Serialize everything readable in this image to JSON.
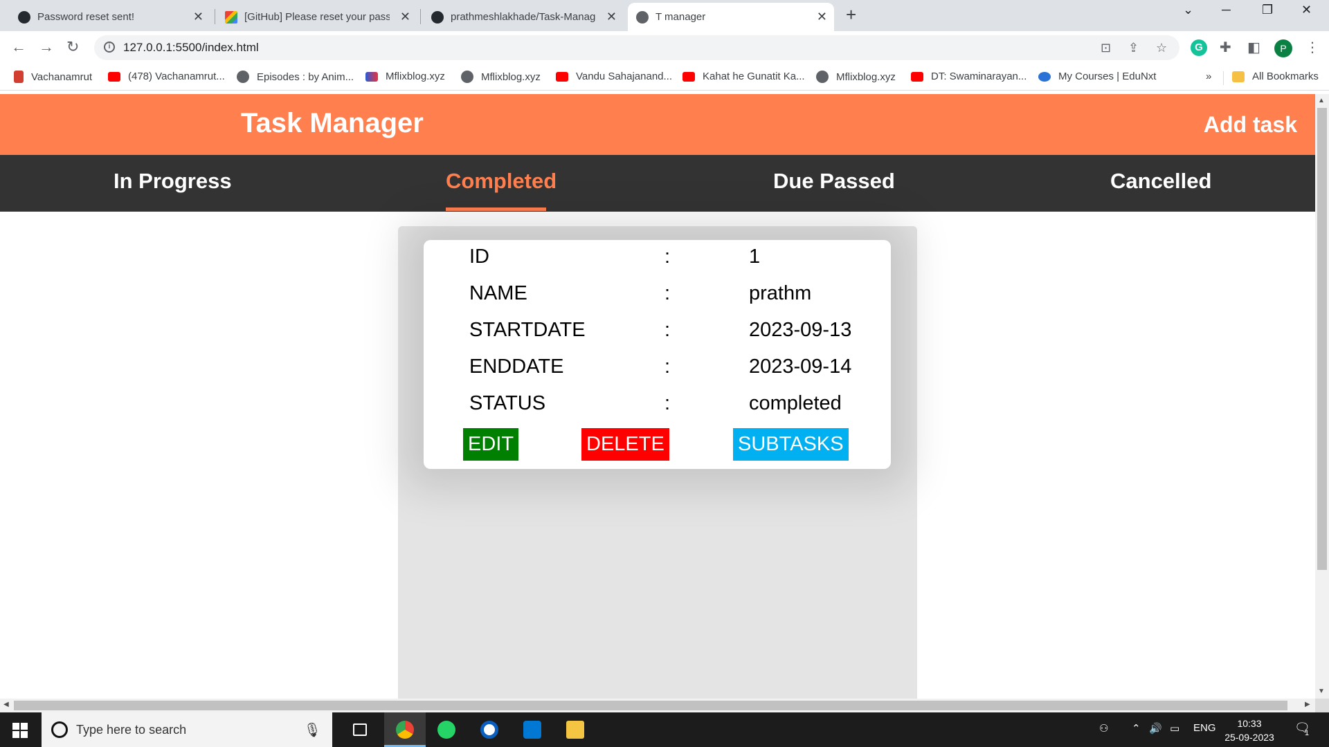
{
  "browser": {
    "tabs": [
      {
        "title": "Password reset sent!",
        "icon": "github-icon"
      },
      {
        "title": "[GitHub] Please reset your passw",
        "icon": "gmail-icon"
      },
      {
        "title": "prathmeshlakhade/Task-Manage",
        "icon": "github-icon"
      },
      {
        "title": "T manager",
        "icon": "globe-icon",
        "active": true
      }
    ],
    "new_tab": "+",
    "url": "127.0.0.1:5500/index.html",
    "profile_initial": "P",
    "grammarly_initial": "G",
    "bookmarks": [
      "Vachanamrut",
      "(478) Vachanamrut...",
      "Episodes : by Anim...",
      "Mflixblog.xyz",
      "Mflixblog.xyz",
      "Vandu Sahajanand...",
      "Kahat he Gunatit Ka...",
      "Mflixblog.xyz",
      "DT: Swaminarayan...",
      "My Courses | EduNxt"
    ],
    "overflow": "»",
    "all_bookmarks": "All Bookmarks"
  },
  "app": {
    "title": "Task Manager",
    "add_task": "Add task",
    "nav": {
      "in_progress": "In Progress",
      "completed": "Completed",
      "due_passed": "Due Passed",
      "cancelled": "Cancelled",
      "active": "Completed"
    },
    "task": {
      "separator": ":",
      "fields": [
        {
          "label": "ID",
          "value": "1"
        },
        {
          "label": "NAME",
          "value": "prathm"
        },
        {
          "label": "STARTDATE",
          "value": "2023-09-13"
        },
        {
          "label": "ENDDATE",
          "value": "2023-09-14"
        },
        {
          "label": "STATUS",
          "value": "completed"
        }
      ],
      "buttons": {
        "edit": "EDIT",
        "delete": "DELETE",
        "subtasks": "SUBTASKS"
      }
    },
    "colors": {
      "header": "#ff7f4f",
      "nav": "#333333",
      "edit": "#008000",
      "delete": "#ff0000",
      "subtasks": "#00b0f0"
    }
  },
  "taskbar": {
    "search_placeholder": "Type here to search",
    "language": "ENG",
    "time": "10:33",
    "date": "25-09-2023",
    "notification_count": "1"
  }
}
